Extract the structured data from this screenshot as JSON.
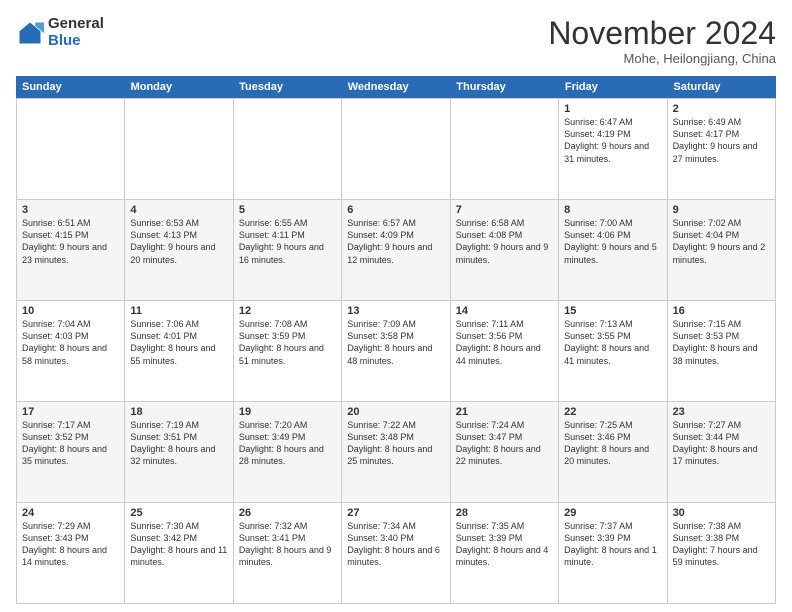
{
  "logo": {
    "general": "General",
    "blue": "Blue"
  },
  "title": "November 2024",
  "location": "Mohe, Heilongjiang, China",
  "days": [
    "Sunday",
    "Monday",
    "Tuesday",
    "Wednesday",
    "Thursday",
    "Friday",
    "Saturday"
  ],
  "weeks": [
    [
      {
        "day": "",
        "info": ""
      },
      {
        "day": "",
        "info": ""
      },
      {
        "day": "",
        "info": ""
      },
      {
        "day": "",
        "info": ""
      },
      {
        "day": "",
        "info": ""
      },
      {
        "day": "1",
        "info": "Sunrise: 6:47 AM\nSunset: 4:19 PM\nDaylight: 9 hours\nand 31 minutes."
      },
      {
        "day": "2",
        "info": "Sunrise: 6:49 AM\nSunset: 4:17 PM\nDaylight: 9 hours\nand 27 minutes."
      }
    ],
    [
      {
        "day": "3",
        "info": "Sunrise: 6:51 AM\nSunset: 4:15 PM\nDaylight: 9 hours\nand 23 minutes."
      },
      {
        "day": "4",
        "info": "Sunrise: 6:53 AM\nSunset: 4:13 PM\nDaylight: 9 hours\nand 20 minutes."
      },
      {
        "day": "5",
        "info": "Sunrise: 6:55 AM\nSunset: 4:11 PM\nDaylight: 9 hours\nand 16 minutes."
      },
      {
        "day": "6",
        "info": "Sunrise: 6:57 AM\nSunset: 4:09 PM\nDaylight: 9 hours\nand 12 minutes."
      },
      {
        "day": "7",
        "info": "Sunrise: 6:58 AM\nSunset: 4:08 PM\nDaylight: 9 hours\nand 9 minutes."
      },
      {
        "day": "8",
        "info": "Sunrise: 7:00 AM\nSunset: 4:06 PM\nDaylight: 9 hours\nand 5 minutes."
      },
      {
        "day": "9",
        "info": "Sunrise: 7:02 AM\nSunset: 4:04 PM\nDaylight: 9 hours\nand 2 minutes."
      }
    ],
    [
      {
        "day": "10",
        "info": "Sunrise: 7:04 AM\nSunset: 4:03 PM\nDaylight: 8 hours\nand 58 minutes."
      },
      {
        "day": "11",
        "info": "Sunrise: 7:06 AM\nSunset: 4:01 PM\nDaylight: 8 hours\nand 55 minutes."
      },
      {
        "day": "12",
        "info": "Sunrise: 7:08 AM\nSunset: 3:59 PM\nDaylight: 8 hours\nand 51 minutes."
      },
      {
        "day": "13",
        "info": "Sunrise: 7:09 AM\nSunset: 3:58 PM\nDaylight: 8 hours\nand 48 minutes."
      },
      {
        "day": "14",
        "info": "Sunrise: 7:11 AM\nSunset: 3:56 PM\nDaylight: 8 hours\nand 44 minutes."
      },
      {
        "day": "15",
        "info": "Sunrise: 7:13 AM\nSunset: 3:55 PM\nDaylight: 8 hours\nand 41 minutes."
      },
      {
        "day": "16",
        "info": "Sunrise: 7:15 AM\nSunset: 3:53 PM\nDaylight: 8 hours\nand 38 minutes."
      }
    ],
    [
      {
        "day": "17",
        "info": "Sunrise: 7:17 AM\nSunset: 3:52 PM\nDaylight: 8 hours\nand 35 minutes."
      },
      {
        "day": "18",
        "info": "Sunrise: 7:19 AM\nSunset: 3:51 PM\nDaylight: 8 hours\nand 32 minutes."
      },
      {
        "day": "19",
        "info": "Sunrise: 7:20 AM\nSunset: 3:49 PM\nDaylight: 8 hours\nand 28 minutes."
      },
      {
        "day": "20",
        "info": "Sunrise: 7:22 AM\nSunset: 3:48 PM\nDaylight: 8 hours\nand 25 minutes."
      },
      {
        "day": "21",
        "info": "Sunrise: 7:24 AM\nSunset: 3:47 PM\nDaylight: 8 hours\nand 22 minutes."
      },
      {
        "day": "22",
        "info": "Sunrise: 7:25 AM\nSunset: 3:46 PM\nDaylight: 8 hours\nand 20 minutes."
      },
      {
        "day": "23",
        "info": "Sunrise: 7:27 AM\nSunset: 3:44 PM\nDaylight: 8 hours\nand 17 minutes."
      }
    ],
    [
      {
        "day": "24",
        "info": "Sunrise: 7:29 AM\nSunset: 3:43 PM\nDaylight: 8 hours\nand 14 minutes."
      },
      {
        "day": "25",
        "info": "Sunrise: 7:30 AM\nSunset: 3:42 PM\nDaylight: 8 hours\nand 11 minutes."
      },
      {
        "day": "26",
        "info": "Sunrise: 7:32 AM\nSunset: 3:41 PM\nDaylight: 8 hours\nand 9 minutes."
      },
      {
        "day": "27",
        "info": "Sunrise: 7:34 AM\nSunset: 3:40 PM\nDaylight: 8 hours\nand 6 minutes."
      },
      {
        "day": "28",
        "info": "Sunrise: 7:35 AM\nSunset: 3:39 PM\nDaylight: 8 hours\nand 4 minutes."
      },
      {
        "day": "29",
        "info": "Sunrise: 7:37 AM\nSunset: 3:39 PM\nDaylight: 8 hours\nand 1 minute."
      },
      {
        "day": "30",
        "info": "Sunrise: 7:38 AM\nSunset: 3:38 PM\nDaylight: 7 hours\nand 59 minutes."
      }
    ]
  ]
}
